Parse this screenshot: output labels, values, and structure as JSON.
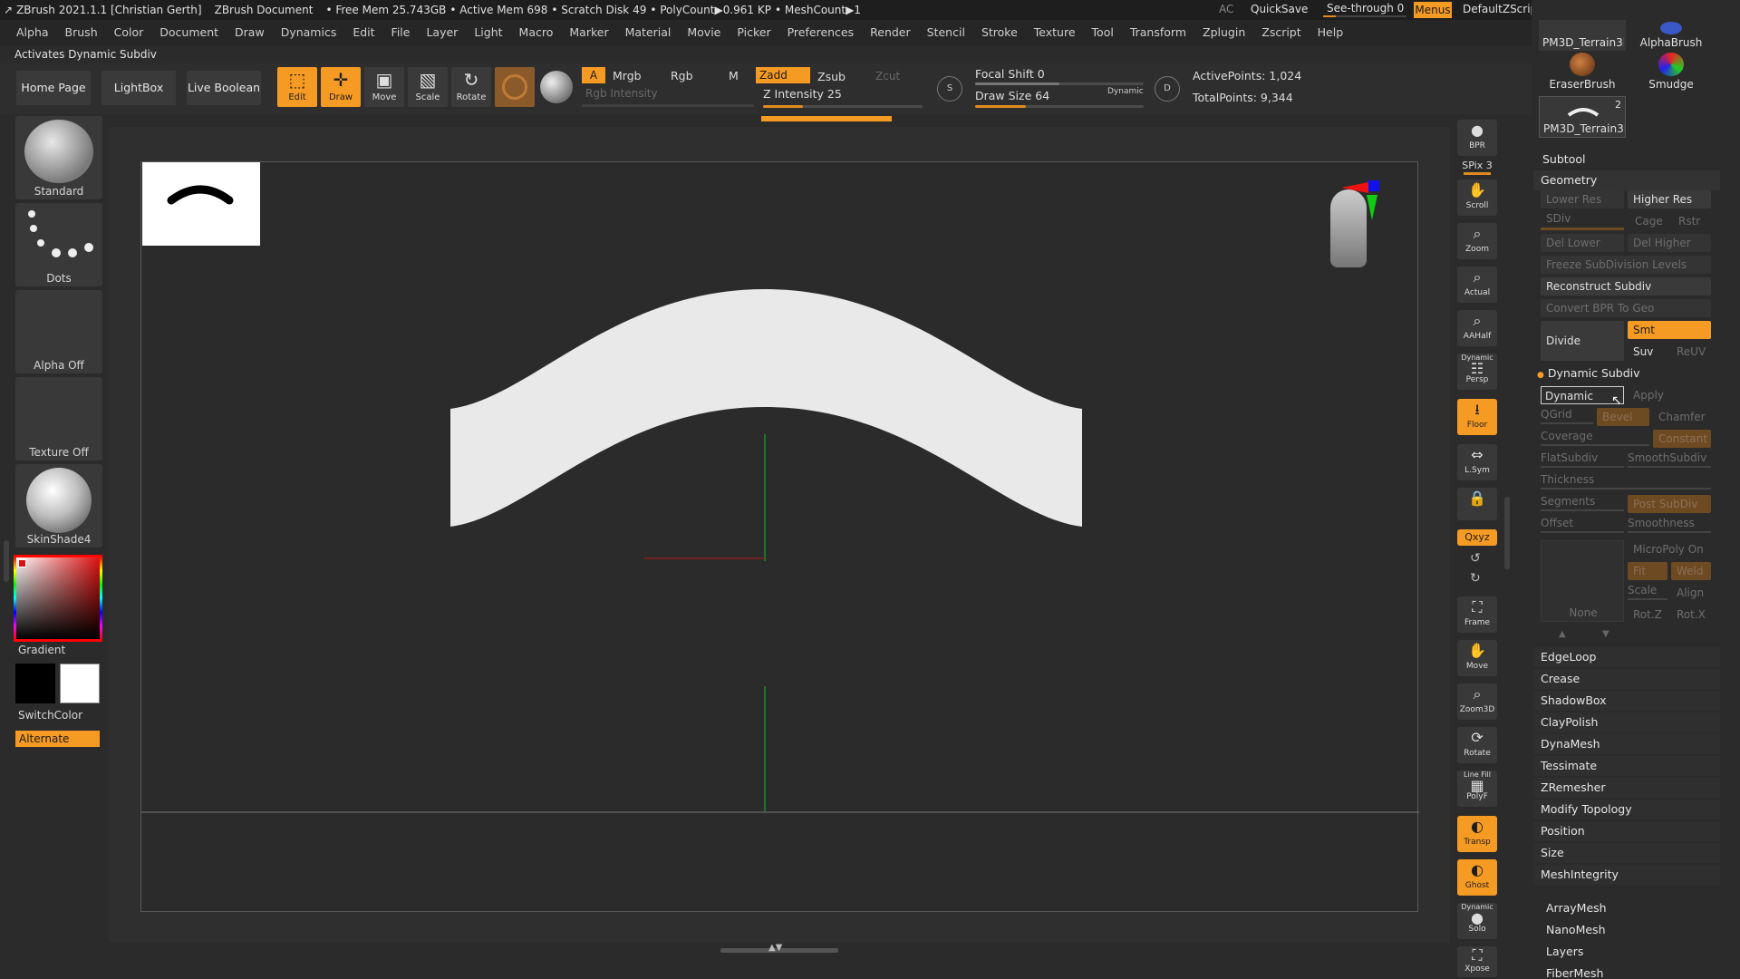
{
  "titlebar": {
    "app": "ZBrush 2021.1.1 [Christian Gerth]",
    "document": "ZBrush Document",
    "free_mem": "• Free Mem 25.743GB",
    "active_mem": "• Active Mem 698",
    "scratch": "• Scratch Disk 49",
    "polycount": "• PolyCount▶0.961 KP",
    "meshcount": "• MeshCount▶1",
    "ac": "AC",
    "quicksave": "QuickSave",
    "seethrough": "See-through  0",
    "menus": "Menus",
    "script": "DefaultZScript"
  },
  "menubar": [
    "Alpha",
    "Brush",
    "Color",
    "Document",
    "Draw",
    "Dynamics",
    "Edit",
    "File",
    "Layer",
    "Light",
    "Macro",
    "Marker",
    "Material",
    "Movie",
    "Picker",
    "Preferences",
    "Render",
    "Stencil",
    "Stroke",
    "Texture",
    "Tool",
    "Transform",
    "Zplugin",
    "Zscript",
    "Help"
  ],
  "status": "Activates Dynamic Subdiv",
  "toolbar": {
    "home": "Home Page",
    "lightbox": "LightBox",
    "liveboolean": "Live Boolean",
    "edit": "Edit",
    "draw": "Draw",
    "move": "Move",
    "scale": "Scale",
    "rotate": "Rotate",
    "a": "A",
    "mrgb": "Mrgb",
    "rgb": "Rgb",
    "m": "M",
    "rgb_intensity": "Rgb Intensity",
    "zadd": "Zadd",
    "zsub": "Zsub",
    "zcut": "Zcut",
    "z_intensity": "Z Intensity 25",
    "focal_shift": "Focal Shift 0",
    "draw_size": "Draw Size 64",
    "dynamic": "Dynamic",
    "active_points": "ActivePoints: 1,024",
    "total_points": "TotalPoints: 9,344",
    "z_intensity_level": 0.25,
    "focal_level": 0.5,
    "drawsize_level": 0.3
  },
  "left": {
    "standard": "Standard",
    "dots": "Dots",
    "alpha_off": "Alpha Off",
    "texture_off": "Texture Off",
    "skinshade": "SkinShade4",
    "gradient": "Gradient",
    "switchcolor": "SwitchColor",
    "alternate": "Alternate"
  },
  "rightshelf": {
    "bpr": "BPR",
    "spix": "SPix 3",
    "scroll": "Scroll",
    "zoom": "Zoom",
    "actual": "Actual",
    "aahalf": "AAHalf",
    "dynamic": "Dynamic",
    "persp": "Persp",
    "floor": "Floor",
    "lsym": "L.Sym",
    "xyz": "Qxyz",
    "frame": "Frame",
    "move": "Move",
    "zoom3d": "Zoom3D",
    "rotate": "Rotate",
    "linefill": "Line Fill",
    "polyf": "PolyF",
    "transp": "Transp",
    "ghost": "Ghost",
    "solo_top": "Dynamic",
    "solo": "Solo",
    "xpose": "Xpose"
  },
  "panel": {
    "brush1": "PM3D_Terrain3D",
    "brush2": "AlphaBrush",
    "brush3": "EraserBrush",
    "brush4": "Smudge",
    "brush5": "PM3D_Terrain3D",
    "brush5_count": "2",
    "subtool": "Subtool",
    "geometry": "Geometry",
    "lower_res": "Lower Res",
    "higher_res": "Higher Res",
    "sdiv": "SDiv",
    "cage": "Cage",
    "rstr": "Rstr",
    "del_lower": "Del Lower",
    "del_higher": "Del Higher",
    "freeze": "Freeze SubDivision Levels",
    "reconstruct": "Reconstruct Subdiv",
    "convert_bpr": "Convert BPR To Geo",
    "divide": "Divide",
    "smt": "Smt",
    "suv": "Suv",
    "reuv": "ReUV",
    "dynamic_subdiv": "Dynamic Subdiv",
    "dynamic_btn": "Dynamic",
    "apply": "Apply",
    "qgrid": "QGrid",
    "bevel": "Bevel",
    "chamfer": "Chamfer",
    "coverage": "Coverage",
    "constant": "Constant",
    "flatsubdiv": "FlatSubdiv",
    "smoothsubdiv": "SmoothSubdiv",
    "thickness": "Thickness",
    "segments": "Segments",
    "post_subdiv": "Post SubDiv",
    "offset": "Offset",
    "smoothness": "Smoothness",
    "micropoly": "MicroPoly On",
    "fit": "Fit",
    "weld": "Weld",
    "scale": "Scale",
    "align": "Align",
    "none": "None",
    "rotz": "Rot.Z",
    "rotx": "Rot.X",
    "sections": [
      "EdgeLoop",
      "Crease",
      "ShadowBox",
      "ClayPolish",
      "DynaMesh",
      "Tessimate",
      "ZRemesher",
      "Modify Topology",
      "Position",
      "Size",
      "MeshIntegrity"
    ],
    "bottom": [
      "ArrayMesh",
      "NanoMesh",
      "Layers",
      "FiberMesh"
    ]
  },
  "colors": {
    "accent": "#f59a23",
    "background": "#2b2b2b"
  }
}
